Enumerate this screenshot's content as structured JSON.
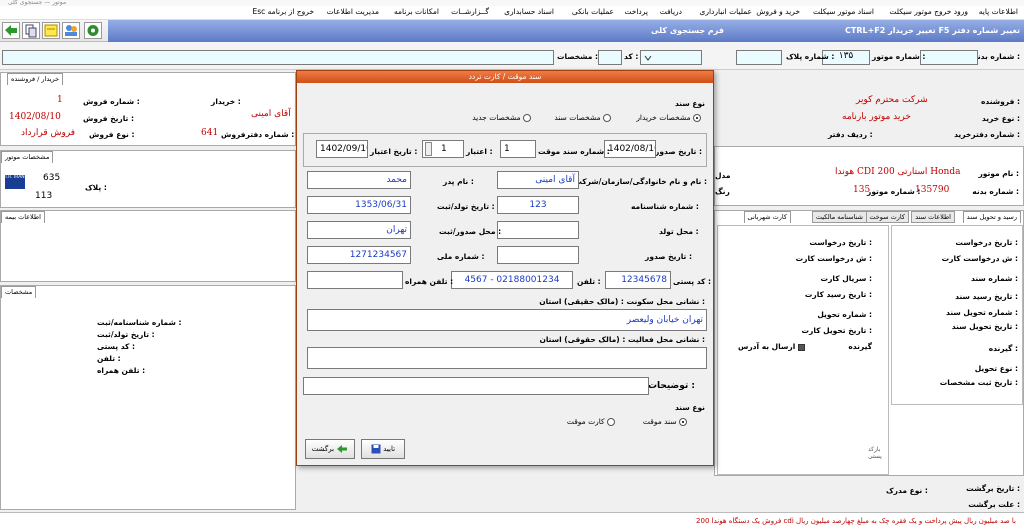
{
  "window": {
    "title": "موتور — جستجوی کلی"
  },
  "menu": [
    "اطلاعات پایه",
    "ورود خروج موتور سیکلت",
    "اسناد موتور سیکلت",
    "خرید و فروش",
    "عملیات انبارداری",
    "دریافت",
    "پرداخت",
    "عملیات بانکی",
    "اسناد حسابداری",
    "گــزارشــات",
    "امکانات برنامه",
    "مدیریت اطلاعات",
    "خروج از برنامه Esc"
  ],
  "header": {
    "title": "تغییر شماره دفتر F5  تغییر خریدار  CTRL+F2",
    "search_label": "فرم جستجوی کلی"
  },
  "search": {
    "body_label": "شماره بدنه :",
    "engine_label": "شماره موتور :",
    "engine_value": "۱۳۵",
    "plate_label": "شماره پلاک :",
    "code_label": "کد :",
    "spec_label": "مشخصات :"
  },
  "seller": {
    "label": "فروشنده :",
    "value": "شرکت محترم کویر",
    "type_label": "نوع خرید :",
    "type_value": "خرید موتور بارنامه",
    "book_label": "شماره دفترخرید :",
    "book_row_label": "ردیف دفتر :"
  },
  "buyer_panel": {
    "tab": "خریدار / فروشنده",
    "buyer_label": "خریدار :",
    "buyer_value": "آقای امینی",
    "sale_no_label": "شماره فروش :",
    "sale_no_value": "1",
    "sale_date_label": "تاریخ فروش :",
    "sale_date_value": "1402/08/10",
    "sale_type_label": "نوع فروش :",
    "sale_type_value": "فروش قرارداد",
    "sale_book_label": "شماره دفترفروش :",
    "sale_book_value": "641"
  },
  "engine_panel": {
    "tab": "مشخصات موتور",
    "plate_label": "پلاک :",
    "plate_top": "635",
    "plate_bottom": "113",
    "flag": "I.R. IRAN"
  },
  "motor_info": {
    "name_label": "نام موتور :",
    "name_value": "هوندا CDI 200 استارتی Honda",
    "body_label": "شماره بدنه :",
    "body_value": "135790",
    "engine_label": "شماره موتور :",
    "engine_value": "135",
    "color_label": "رنگ",
    "model_label": "مدل"
  },
  "left_tabs": {
    "insurance": "اطلاعات بیمه",
    "specs": "مشخصات"
  },
  "left_fields": [
    "شماره شناسنامه/ثبت :",
    "تاریخ تولد/ثبت :",
    "کد پستی :",
    "تلفن :",
    "تلفن همراه :"
  ],
  "right_tabs": [
    "رسید و تحویل سند",
    "اطلاعات سند",
    "کارت سوخت",
    "شناسنامه مالکیت",
    "کارت شهربانی"
  ],
  "doc_fields": [
    "تاریخ درخواست :",
    "ش درخواست کارت :",
    "شماره سند :",
    "تاریخ رسید سند :",
    "شماره تحویل سند :",
    "تاریخ تحویل سند :",
    "گیرنده :",
    "نوع تحویل :",
    "تاریخ ثبت مشخصات :"
  ],
  "card_fields": [
    "تاریخ درخواست :",
    "ش درخواست کارت :",
    "سریال کارت :",
    "تاریخ رسید کارت :",
    "شماره تحویل :",
    "تاریخ تحویل کارت :",
    "گیرنده"
  ],
  "send_address": "ارسال به آدرس",
  "barcode": "بارکد پستی",
  "bottom": {
    "courier_label": "نوع مدرک :",
    "return_date": "تاریخ برگشت :",
    "return_reason": "علت برگشت :"
  },
  "modal": {
    "title": "سند موقت / کارت تردد",
    "doc_type_label": "نوع سند",
    "radio_buyer": "مشخصات خریدار",
    "radio_doc": "مشخصات سند",
    "radio_new": "مشخصات جدید",
    "issue_date_label": "تاریخ صدور :",
    "issue_date": "1402/08/10",
    "temp_no_label": "شماره سند موقت :",
    "temp_no": "1",
    "validity_label": "اعتبار :",
    "validity": "1",
    "validity_date_label": "تاریخ اعتبار :",
    "validity_date": "1402/09/10",
    "name_label": "نام و نام خانوادگی/سازمان/شرکت :",
    "name": "آقای امینی",
    "father_label": "نام پدر :",
    "father": "محمد",
    "id_label": "شماره شناسنامه :",
    "id": "123",
    "birth_label": "تاریخ تولد/ثبت :",
    "birth": "1353/06/31",
    "birthplace_label": "محل تولد :",
    "issue_place_label": "محل صدور/ثبت :",
    "issue_place": "تهران",
    "issue_date2_label": "تاریخ صدور :",
    "national_label": "شماره ملی :",
    "national": "1271234567",
    "postal_label": "کد پستی :",
    "postal": "12345678",
    "phone_label": "تلفن :",
    "phone": "4567 - 02188001234",
    "mobile_label": "تلفن همراه :",
    "addr_label": "نشانی محل سکونت : (مالک حقیقی) استان :",
    "addr": "تهران خیابان ولیعصر",
    "work_label": "نشانی محل فعالیت : (مالک حقوقی) استان :",
    "notes_label": "توضیحات :",
    "doc_type2_label": "نوع سند",
    "radio_temp": "سند موقت",
    "radio_card": "کارت موقت",
    "confirm": "تایید",
    "back": "برگشت"
  },
  "status": "فروش یک دستگاه هوندا 200 cdi با صد میلیون ریال پیش پرداخت و یک فقره چک به مبلغ چهارصد میلیون ریال"
}
